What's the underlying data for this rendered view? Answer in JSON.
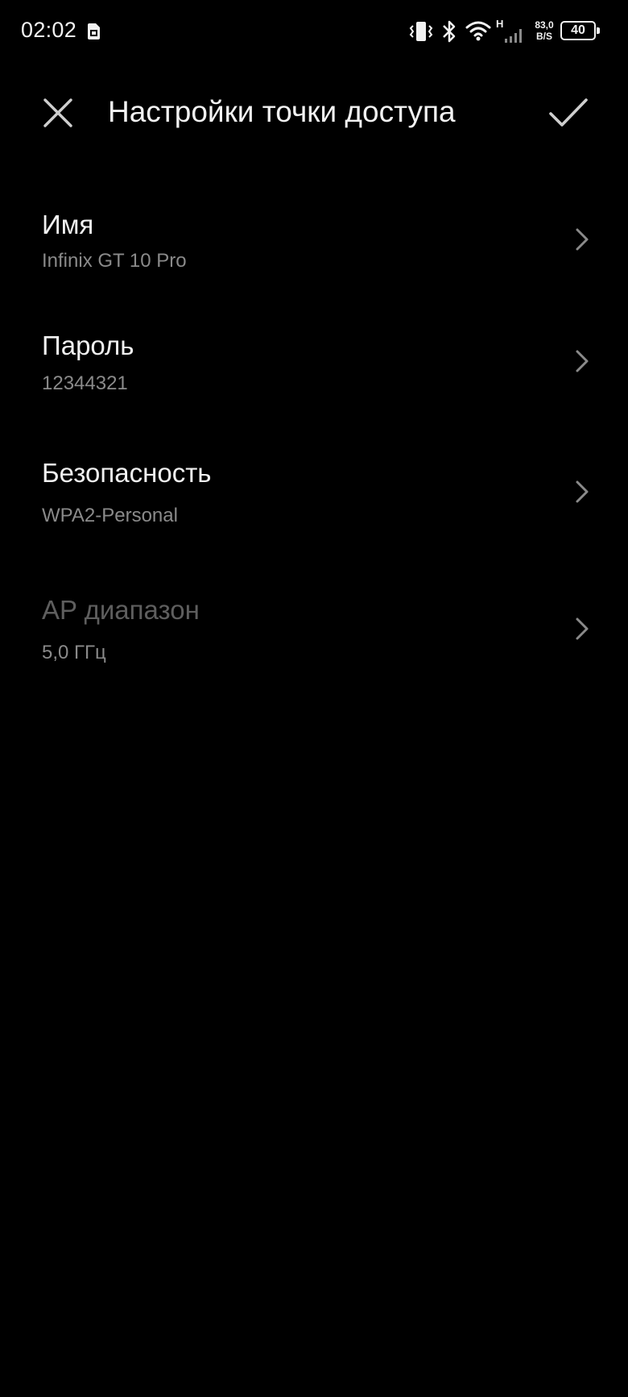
{
  "status_bar": {
    "time": "02:02",
    "network_type": "H",
    "net_speed_value": "83,0",
    "net_speed_unit": "B/S",
    "battery_level": "40",
    "battery_fraction": 0.4,
    "icons": [
      "sim-card-icon",
      "vibrate-icon",
      "bluetooth-icon",
      "wifi-icon",
      "signal-icon",
      "battery-icon"
    ]
  },
  "header": {
    "title": "Настройки точки доступа",
    "close_icon": "close-icon",
    "confirm_icon": "check-icon"
  },
  "settings": {
    "name": {
      "label": "Имя",
      "value": "Infinix GT 10 Pro",
      "enabled": true
    },
    "password": {
      "label": "Пароль",
      "value": "12344321",
      "enabled": true
    },
    "security": {
      "label": "Безопасность",
      "value": "WPA2-Personal",
      "enabled": true
    },
    "ap_band": {
      "label": "AP диапазон",
      "value": "5,0 ГГц",
      "enabled": false
    }
  },
  "colors": {
    "background": "#000000",
    "primary_text": "#f0f0f0",
    "secondary_text": "#8a8a8a",
    "disabled_text": "#5e5e5e",
    "icon": "#cfcfcf",
    "chevron": "#8a8a8a"
  }
}
